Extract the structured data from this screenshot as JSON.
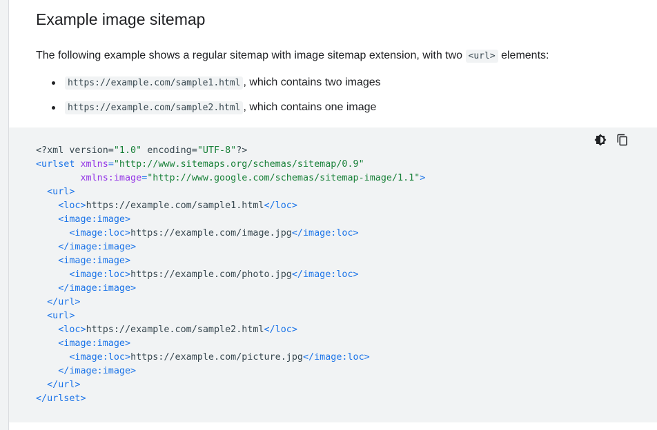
{
  "section": {
    "title": "Example image sitemap",
    "intro_before": "The following example shows a regular sitemap with image sitemap extension, with two ",
    "intro_code": "<url>",
    "intro_after": " elements:",
    "bullets": [
      {
        "code": "https://example.com/sample1.html",
        "text": ", which contains two images"
      },
      {
        "code": "https://example.com/sample2.html",
        "text": ", which contains one image"
      }
    ]
  },
  "code_tools": {
    "theme_icon": "dark-mode-icon",
    "copy_icon": "copy-icon"
  },
  "code_lines": [
    [
      {
        "c": "tx",
        "t": "<?xml version="
      },
      {
        "c": "st",
        "t": "\"1.0\""
      },
      {
        "c": "tx",
        "t": " encoding="
      },
      {
        "c": "st",
        "t": "\"UTF-8\""
      },
      {
        "c": "tx",
        "t": "?>"
      }
    ],
    [
      {
        "c": "tg",
        "t": "<urlset "
      },
      {
        "c": "at",
        "t": "xmlns"
      },
      {
        "c": "tg",
        "t": "="
      },
      {
        "c": "st",
        "t": "\"http://www.sitemaps.org/schemas/sitemap/0.9\""
      }
    ],
    [
      {
        "c": "tx",
        "t": "        "
      },
      {
        "c": "at",
        "t": "xmlns:image"
      },
      {
        "c": "tg",
        "t": "="
      },
      {
        "c": "st",
        "t": "\"http://www.google.com/schemas/sitemap-image/1.1\""
      },
      {
        "c": "tg",
        "t": ">"
      }
    ],
    [
      {
        "c": "tx",
        "t": "  "
      },
      {
        "c": "tg",
        "t": "<url>"
      }
    ],
    [
      {
        "c": "tx",
        "t": "    "
      },
      {
        "c": "tg",
        "t": "<loc>"
      },
      {
        "c": "tx",
        "t": "https://example.com/sample1.html"
      },
      {
        "c": "tg",
        "t": "</loc>"
      }
    ],
    [
      {
        "c": "tx",
        "t": "    "
      },
      {
        "c": "tg",
        "t": "<image:image>"
      }
    ],
    [
      {
        "c": "tx",
        "t": "      "
      },
      {
        "c": "tg",
        "t": "<image:loc>"
      },
      {
        "c": "tx",
        "t": "https://example.com/image.jpg"
      },
      {
        "c": "tg",
        "t": "</image:loc>"
      }
    ],
    [
      {
        "c": "tx",
        "t": "    "
      },
      {
        "c": "tg",
        "t": "</image:image>"
      }
    ],
    [
      {
        "c": "tx",
        "t": "    "
      },
      {
        "c": "tg",
        "t": "<image:image>"
      }
    ],
    [
      {
        "c": "tx",
        "t": "      "
      },
      {
        "c": "tg",
        "t": "<image:loc>"
      },
      {
        "c": "tx",
        "t": "https://example.com/photo.jpg"
      },
      {
        "c": "tg",
        "t": "</image:loc>"
      }
    ],
    [
      {
        "c": "tx",
        "t": "    "
      },
      {
        "c": "tg",
        "t": "</image:image>"
      }
    ],
    [
      {
        "c": "tx",
        "t": "  "
      },
      {
        "c": "tg",
        "t": "</url>"
      }
    ],
    [
      {
        "c": "tx",
        "t": "  "
      },
      {
        "c": "tg",
        "t": "<url>"
      }
    ],
    [
      {
        "c": "tx",
        "t": "    "
      },
      {
        "c": "tg",
        "t": "<loc>"
      },
      {
        "c": "tx",
        "t": "https://example.com/sample2.html"
      },
      {
        "c": "tg",
        "t": "</loc>"
      }
    ],
    [
      {
        "c": "tx",
        "t": "    "
      },
      {
        "c": "tg",
        "t": "<image:image>"
      }
    ],
    [
      {
        "c": "tx",
        "t": "      "
      },
      {
        "c": "tg",
        "t": "<image:loc>"
      },
      {
        "c": "tx",
        "t": "https://example.com/picture.jpg"
      },
      {
        "c": "tg",
        "t": "</image:loc>"
      }
    ],
    [
      {
        "c": "tx",
        "t": "    "
      },
      {
        "c": "tg",
        "t": "</image:image>"
      }
    ],
    [
      {
        "c": "tx",
        "t": "  "
      },
      {
        "c": "tg",
        "t": "</url>"
      }
    ],
    [
      {
        "c": "tg",
        "t": "</urlset>"
      }
    ]
  ],
  "colors": {
    "tag": "#1a73e8",
    "attribute": "#9334e6",
    "string": "#188038",
    "text": "#37474f",
    "code_background": "#f1f3f4"
  }
}
